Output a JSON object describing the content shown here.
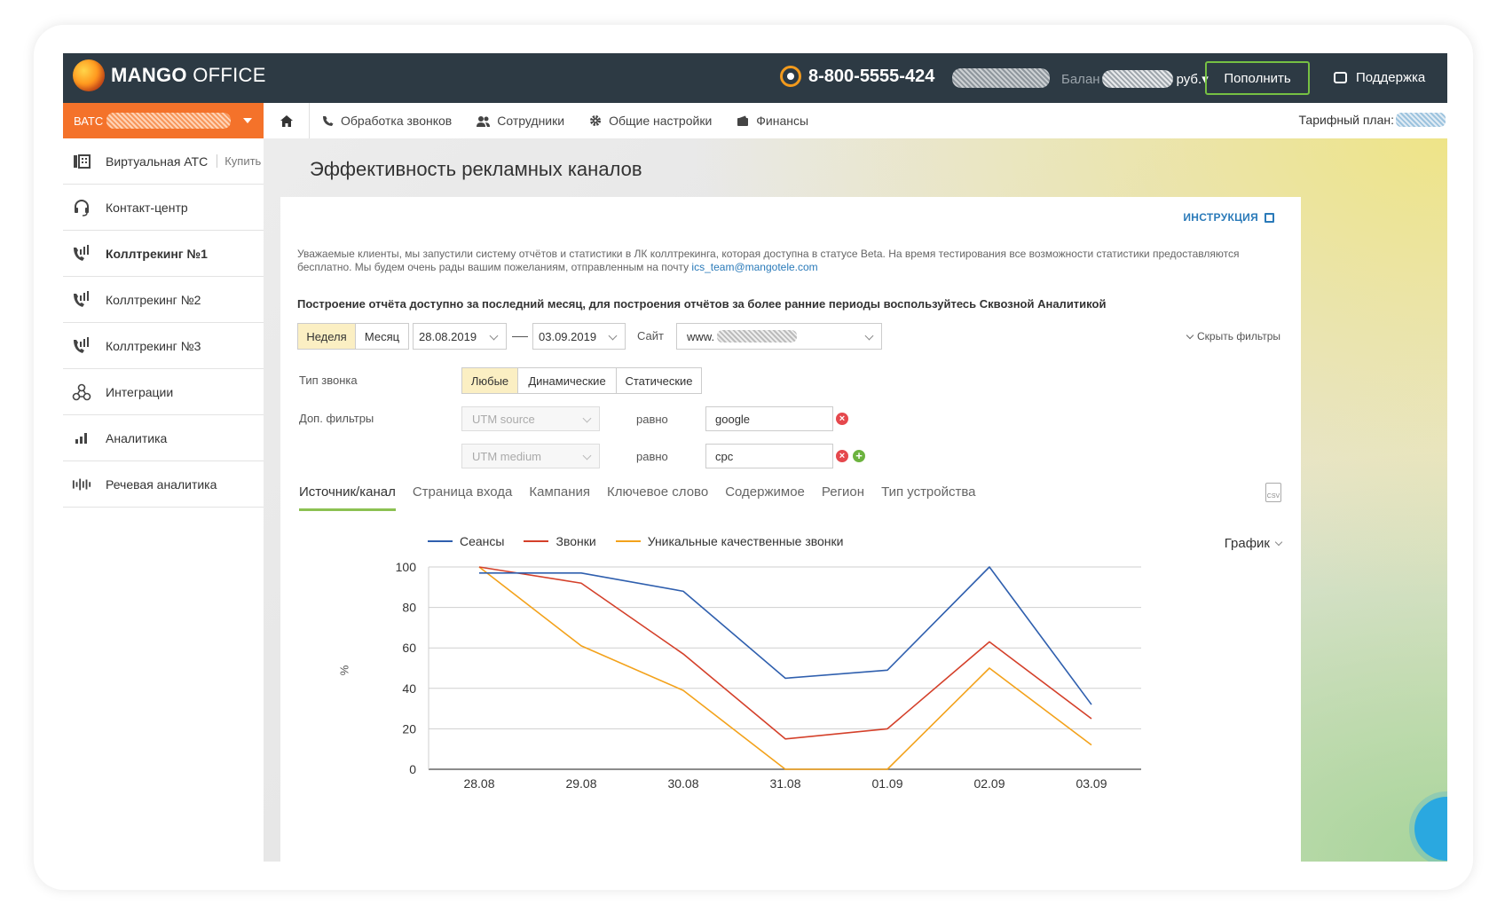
{
  "header": {
    "logo_bold": "MANGO",
    "logo_light": " OFFICE",
    "phone": "8-800-5555-424",
    "balance_label": "Балан",
    "balance_suffix": "руб.",
    "topup_label": "Пополнить",
    "support_label": "Поддержка"
  },
  "sidebar": {
    "ats_prefix": "ВАТС",
    "items": [
      {
        "label": "Виртуальная АТС",
        "extra": "Купить",
        "icon": "pbx-icon"
      },
      {
        "label": "Контакт-центр",
        "icon": "headset-icon"
      },
      {
        "label": "Коллтрекинг №1",
        "icon": "calltracking-icon",
        "active": true
      },
      {
        "label": "Коллтрекинг №2",
        "icon": "calltracking-icon"
      },
      {
        "label": "Коллтрекинг №3",
        "icon": "calltracking-icon"
      },
      {
        "label": "Интеграции",
        "icon": "integrations-icon"
      },
      {
        "label": "Аналитика",
        "icon": "bar-chart-icon"
      },
      {
        "label": "Речевая аналитика",
        "icon": "waveform-icon"
      }
    ]
  },
  "topnav": {
    "items": [
      {
        "label": "Обработка звонков",
        "icon": "phone-icon"
      },
      {
        "label": "Сотрудники",
        "icon": "users-icon"
      },
      {
        "label": "Общие настройки",
        "icon": "gear-icon"
      },
      {
        "label": "Финансы",
        "icon": "wallet-icon"
      }
    ],
    "tariff_label": "Тарифный план:"
  },
  "page": {
    "title": "Эффективность рекламных каналов",
    "instructions": "ИНСТРУКЦИЯ",
    "notice": "Уважаемые клиенты, мы запустили систему отчётов и статистики в ЛК коллтрекинга, которая доступна в статусе Beta. На время тестирования все возможности статистики предоставляются бесплатно. Мы будем очень рады вашим пожеланиям, отправленным на почту ",
    "notice_email": "ics_team@mangotele.com",
    "range_info": "Построение отчёта доступно за последний месяц, для построения отчётов за более ранние периоды воспользуйтесь Сквозной Аналитикой"
  },
  "filters": {
    "period": [
      {
        "label": "Неделя",
        "selected": true
      },
      {
        "label": "Месяц",
        "selected": false
      }
    ],
    "date_from": "28.08.2019",
    "date_to": "03.09.2019",
    "site_label": "Сайт",
    "site_value": "www.",
    "hide_filters": "Скрыть фильтры",
    "call_type_label": "Тип звонка",
    "call_types": [
      {
        "label": "Любые",
        "selected": true
      },
      {
        "label": "Динамические",
        "selected": false
      },
      {
        "label": "Статические",
        "selected": false
      }
    ],
    "extra_label": "Доп. фильтры",
    "rows": [
      {
        "field": "UTM source",
        "op": "равно",
        "value": "google"
      },
      {
        "field": "UTM medium",
        "op": "равно",
        "value": "cpc"
      }
    ]
  },
  "tabs": [
    {
      "label": "Источник/канал",
      "active": true
    },
    {
      "label": "Страница входа"
    },
    {
      "label": "Кампания"
    },
    {
      "label": "Ключевое слово"
    },
    {
      "label": "Содержимое"
    },
    {
      "label": "Регион"
    },
    {
      "label": "Тип устройства"
    }
  ],
  "csv_label": "CSV",
  "view_mode": "График",
  "chart_data": {
    "type": "line",
    "categories": [
      "28.08",
      "29.08",
      "30.08",
      "31.08",
      "01.09",
      "02.09",
      "03.09"
    ],
    "ylabel": "%",
    "ylim": [
      0,
      100
    ],
    "yticks": [
      0,
      20,
      40,
      60,
      80,
      100
    ],
    "grid": true,
    "legend": "top-left",
    "series": [
      {
        "name": "Сеансы",
        "color": "#2f5fae",
        "values": [
          97,
          97,
          88,
          45,
          49,
          100,
          32
        ]
      },
      {
        "name": "Звонки",
        "color": "#d4402a",
        "values": [
          100,
          92,
          57,
          15,
          20,
          63,
          25
        ]
      },
      {
        "name": "Уникальные качественные звонки",
        "color": "#f3a21b",
        "values": [
          100,
          61,
          39,
          0,
          0,
          50,
          12
        ]
      }
    ]
  }
}
